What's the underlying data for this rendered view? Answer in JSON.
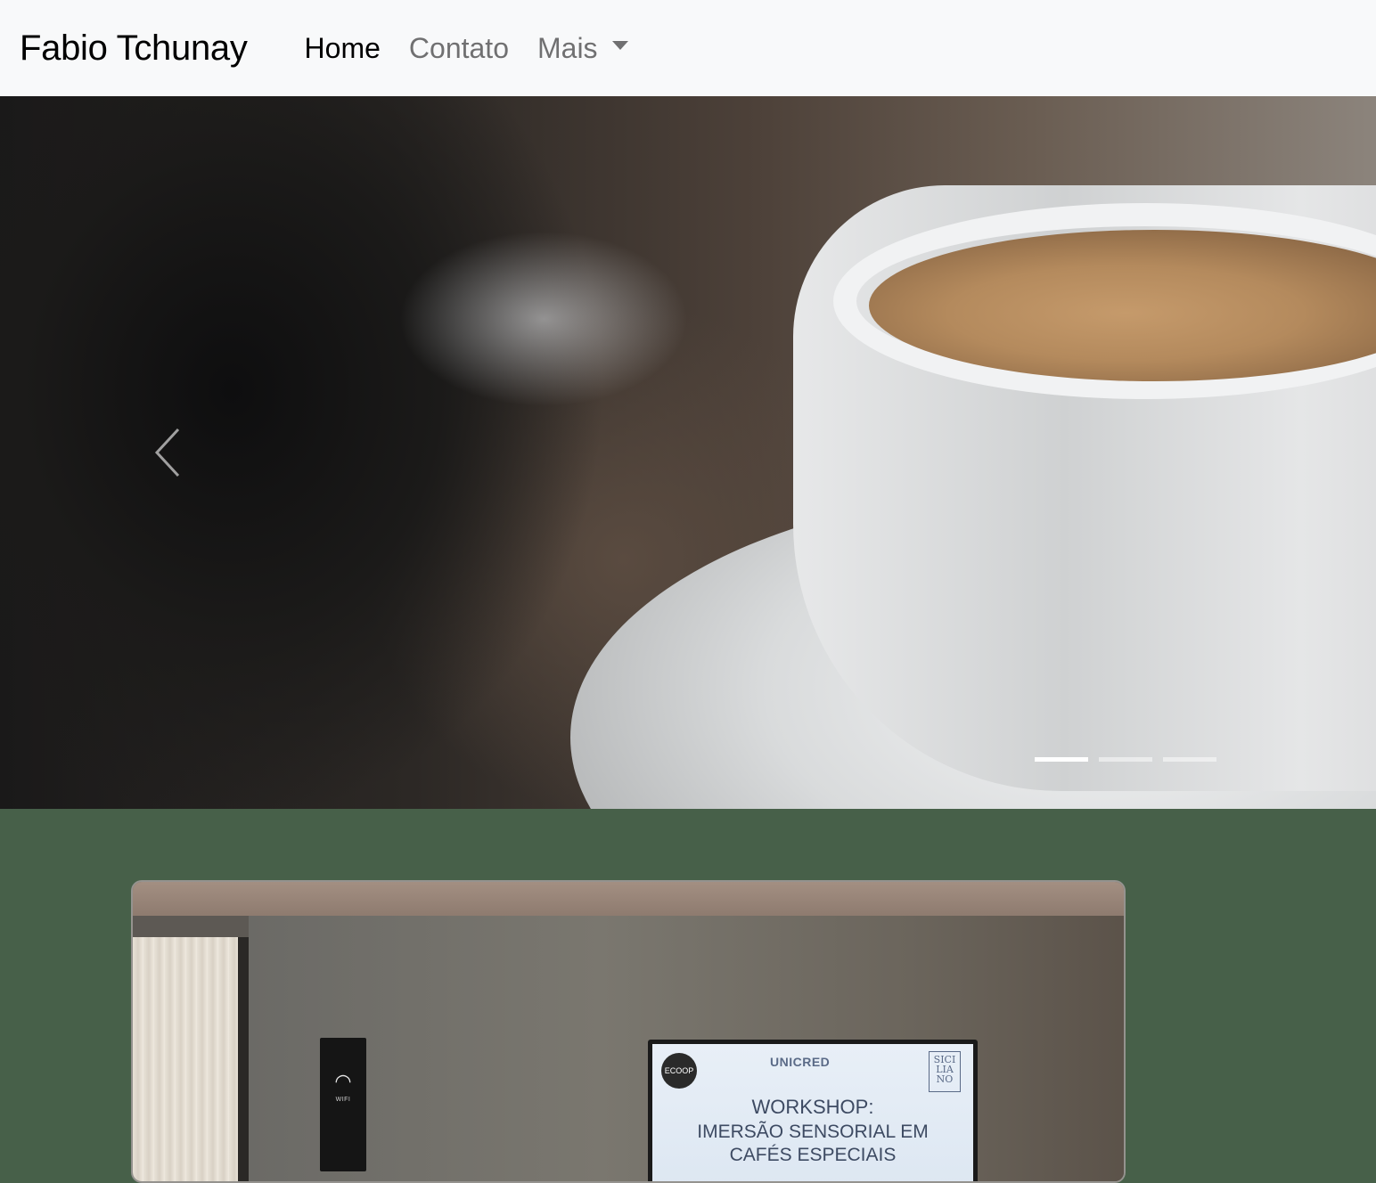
{
  "navbar": {
    "brand": "Fabio Tchunay",
    "links": [
      {
        "label": "Home",
        "active": true
      },
      {
        "label": "Contato",
        "active": false
      },
      {
        "label": "Mais",
        "dropdown": true
      }
    ]
  },
  "carousel": {
    "slide_count": 3,
    "active_index": 0,
    "prev_icon": "chevron-left-icon"
  },
  "card": {
    "photo_text": {
      "wifi_label": "WIFI",
      "tv_badge": "ECOOP",
      "tv_brand": "UNICRED",
      "tv_logo_right": "SICI LIA NO",
      "tv_title": "WORKSHOP:",
      "tv_subtitle_line1": "IMERSÃO SENSORIAL EM",
      "tv_subtitle_line2": "CAFÉS ESPECIAIS"
    }
  },
  "colors": {
    "navbar_bg": "#f8f9fa",
    "section_bg": "#476049",
    "indicator_active": "#ffffff"
  }
}
